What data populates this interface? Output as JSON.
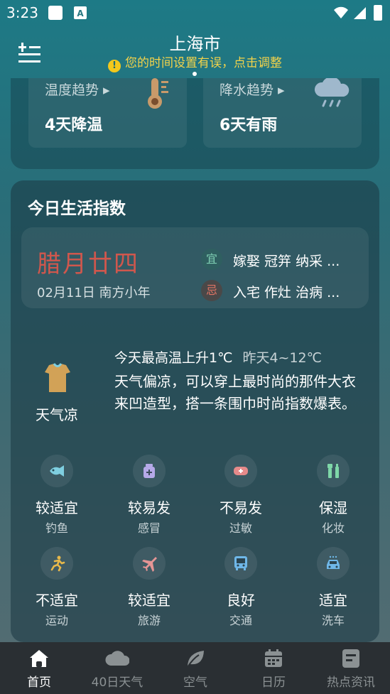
{
  "status_bar": {
    "time": "3:23",
    "icons": [
      "notification-square-icon",
      "app-a-icon",
      "wifi-icon",
      "signal-icon",
      "battery-icon"
    ]
  },
  "header": {
    "city": "上海市",
    "warning": "您的时间设置有误，点击调整",
    "warning_icon": "!",
    "menu_icon": "menu-add-icon"
  },
  "trend": {
    "temperature": {
      "label": "温度趋势",
      "value": "4天降温",
      "icon": "thermometer-icon"
    },
    "precipitation": {
      "label": "降水趋势",
      "value": "6天有雨",
      "icon": "rain-cloud-icon"
    }
  },
  "life": {
    "title": "今日生活指数",
    "almanac": {
      "lunar_date": "腊月廿四",
      "solar_date": "02月11日 南方小年",
      "yi_badge": "宜",
      "yi_text": "嫁娶 冠笄 纳采 ...",
      "ji_badge": "忌",
      "ji_text": "入宅 作灶 治病 ..."
    },
    "clothing": {
      "label": "天气凉",
      "temp_today": "今天最高温上升1℃",
      "temp_yesterday": "昨天4~12℃",
      "description": "天气偏凉，可以穿上最时尚的那件大衣来凹造型，搭一条围巾时尚指数爆表。"
    },
    "indices": [
      {
        "level": "较适宜",
        "name": "钓鱼",
        "icon": "fish-icon"
      },
      {
        "level": "较易发",
        "name": "感冒",
        "icon": "medicine-bottle-icon"
      },
      {
        "level": "不易发",
        "name": "过敏",
        "icon": "mask-icon"
      },
      {
        "level": "保湿",
        "name": "化妆",
        "icon": "cosmetics-icon"
      },
      {
        "level": "不适宜",
        "name": "运动",
        "icon": "running-icon"
      },
      {
        "level": "较适宜",
        "name": "旅游",
        "icon": "airplane-icon"
      },
      {
        "level": "良好",
        "name": "交通",
        "icon": "bus-icon"
      },
      {
        "level": "适宜",
        "name": "洗车",
        "icon": "car-wash-icon"
      }
    ]
  },
  "bottom_nav": [
    {
      "label": "首页",
      "icon": "home-icon",
      "active": true
    },
    {
      "label": "40日天气",
      "icon": "cloud-icon",
      "active": false
    },
    {
      "label": "空气",
      "icon": "leaf-icon",
      "active": false
    },
    {
      "label": "日历",
      "icon": "calendar-icon",
      "active": false
    },
    {
      "label": "热点资讯",
      "icon": "news-icon",
      "active": false
    }
  ],
  "colors": {
    "warning": "#f3d34a",
    "lunar": "#d0574d",
    "nav_bg": "#2a2f33",
    "icon_accent": "#7fcfe0"
  }
}
